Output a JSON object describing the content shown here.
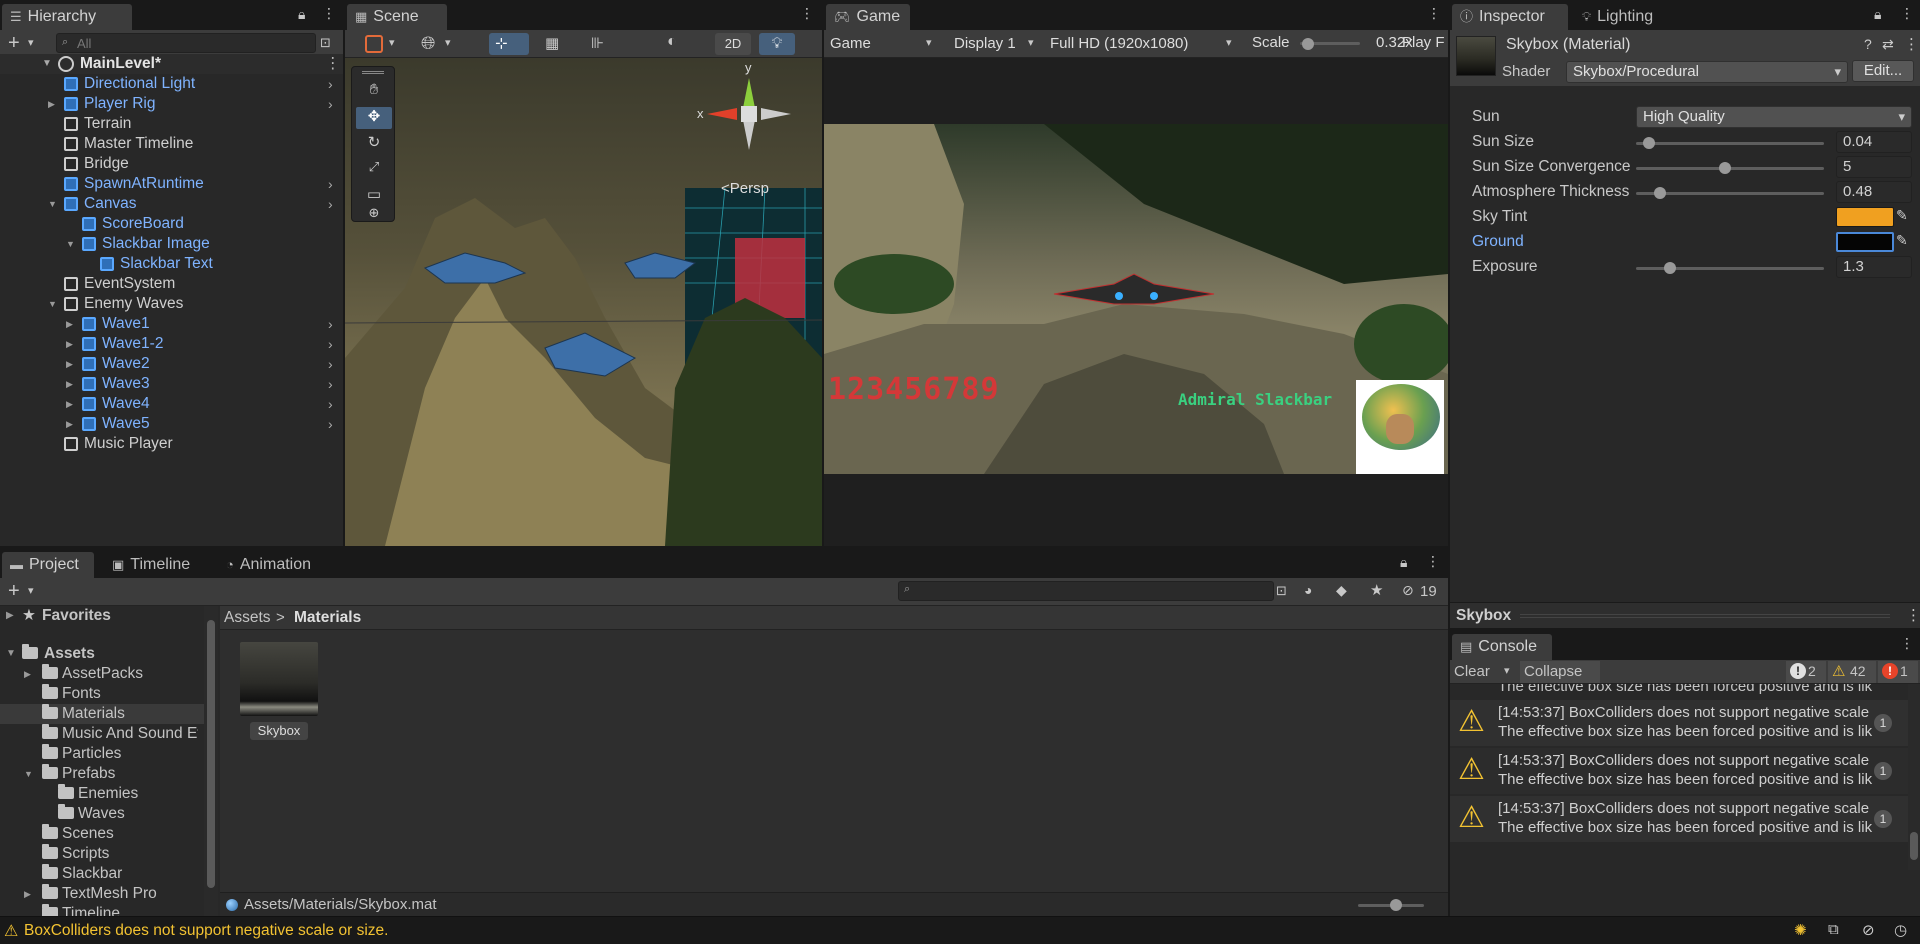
{
  "hierarchy": {
    "tab": "Hierarchy",
    "search_placeholder": "All",
    "scene_name": "MainLevel*",
    "items": [
      {
        "label": "Directional Light",
        "prefab": true,
        "indent": 1,
        "arrow": true,
        "fold": ""
      },
      {
        "label": "Player Rig",
        "prefab": true,
        "indent": 1,
        "arrow": true,
        "fold": "▶"
      },
      {
        "label": "Terrain",
        "prefab": false,
        "indent": 1,
        "arrow": false,
        "fold": ""
      },
      {
        "label": "Master Timeline",
        "prefab": false,
        "indent": 1,
        "arrow": false,
        "fold": ""
      },
      {
        "label": "Bridge",
        "prefab": false,
        "indent": 1,
        "arrow": false,
        "fold": ""
      },
      {
        "label": "SpawnAtRuntime",
        "prefab": true,
        "indent": 1,
        "arrow": true,
        "fold": ""
      },
      {
        "label": "Canvas",
        "prefab": true,
        "indent": 1,
        "arrow": true,
        "fold": "▼"
      },
      {
        "label": "ScoreBoard",
        "prefab": true,
        "indent": 2,
        "arrow": false,
        "fold": ""
      },
      {
        "label": "Slackbar Image",
        "prefab": true,
        "indent": 2,
        "arrow": false,
        "fold": "▼"
      },
      {
        "label": "Slackbar Text",
        "prefab": true,
        "indent": 3,
        "arrow": false,
        "fold": ""
      },
      {
        "label": "EventSystem",
        "prefab": false,
        "indent": 1,
        "arrow": false,
        "fold": ""
      },
      {
        "label": "Enemy Waves",
        "prefab": false,
        "indent": 1,
        "arrow": false,
        "fold": "▼"
      },
      {
        "label": "Wave1",
        "prefab": true,
        "indent": 2,
        "arrow": true,
        "fold": "▶"
      },
      {
        "label": "Wave1-2",
        "prefab": true,
        "indent": 2,
        "arrow": true,
        "fold": "▶"
      },
      {
        "label": "Wave2",
        "prefab": true,
        "indent": 2,
        "arrow": true,
        "fold": "▶"
      },
      {
        "label": "Wave3",
        "prefab": true,
        "indent": 2,
        "arrow": true,
        "fold": "▶"
      },
      {
        "label": "Wave4",
        "prefab": true,
        "indent": 2,
        "arrow": true,
        "fold": "▶"
      },
      {
        "label": "Wave5",
        "prefab": true,
        "indent": 2,
        "arrow": true,
        "fold": "▶"
      },
      {
        "label": "Music Player",
        "prefab": false,
        "indent": 1,
        "arrow": false,
        "fold": ""
      }
    ]
  },
  "scene": {
    "tab": "Scene",
    "btn_2d": "2D",
    "persp_label": "<Persp",
    "gizmo_x": "x",
    "gizmo_y": "y"
  },
  "game": {
    "tab": "Game",
    "mode": "Game",
    "display": "Display 1",
    "resolution": "Full HD (1920x1080)",
    "scale_label": "Scale",
    "scale_value": "0.32x",
    "play_label": "Play F",
    "score_text": "123456789",
    "name_text": "Admiral Slackbar"
  },
  "inspector": {
    "tab_inspector": "Inspector",
    "tab_lighting": "Lighting",
    "material_title": "Skybox (Material)",
    "shader_label": "Shader",
    "shader_value": "Skybox/Procedural",
    "edit_button": "Edit...",
    "properties": {
      "sun_label": "Sun",
      "sun_value": "High Quality",
      "sun_size_label": "Sun Size",
      "sun_size_value": "0.04",
      "sun_size_fraction": 0.04,
      "convergence_label": "Sun Size Convergence",
      "convergence_value": "5",
      "convergence_fraction": 0.47,
      "atmosphere_label": "Atmosphere Thickness",
      "atmosphere_value": "0.48",
      "atmosphere_fraction": 0.1,
      "sky_tint_label": "Sky Tint",
      "sky_tint_color": "#f0a020",
      "ground_label": "Ground",
      "ground_color": "#050505",
      "exposure_label": "Exposure",
      "exposure_value": "1.3",
      "exposure_fraction": 0.16
    },
    "preview_title": "Skybox"
  },
  "project": {
    "tab_project": "Project",
    "tab_timeline": "Timeline",
    "tab_animation": "Animation",
    "hidden_count": "19",
    "favorites": "Favorites",
    "assets_root": "Assets",
    "folders": [
      {
        "label": "AssetPacks",
        "indent": 1,
        "fold": "▶"
      },
      {
        "label": "Fonts",
        "indent": 1,
        "fold": ""
      },
      {
        "label": "Materials",
        "indent": 1,
        "fold": "",
        "selected": true
      },
      {
        "label": "Music And Sound Ef",
        "indent": 1,
        "fold": ""
      },
      {
        "label": "Particles",
        "indent": 1,
        "fold": ""
      },
      {
        "label": "Prefabs",
        "indent": 1,
        "fold": "▼"
      },
      {
        "label": "Enemies",
        "indent": 2,
        "fold": ""
      },
      {
        "label": "Waves",
        "indent": 2,
        "fold": ""
      },
      {
        "label": "Scenes",
        "indent": 1,
        "fold": ""
      },
      {
        "label": "Scripts",
        "indent": 1,
        "fold": ""
      },
      {
        "label": "Slackbar",
        "indent": 1,
        "fold": ""
      },
      {
        "label": "TextMesh Pro",
        "indent": 1,
        "fold": "▶"
      },
      {
        "label": "Timeline",
        "indent": 1,
        "fold": ""
      }
    ],
    "breadcrumb_root": "Assets",
    "breadcrumb_current": "Materials",
    "asset_name": "Skybox",
    "asset_path": "Assets/Materials/Skybox.mat"
  },
  "console": {
    "tab": "Console",
    "clear": "Clear",
    "collapse": "Collapse",
    "info_count": "2",
    "warn_count": "42",
    "error_count": "1",
    "partial_line": "The effective box size has been forced positive and is lik",
    "entries": [
      {
        "line1": "[14:53:37] BoxColliders does not support negative scale",
        "line2": "The effective box size has been forced positive and is lik",
        "count": "1"
      },
      {
        "line1": "[14:53:37] BoxColliders does not support negative scale",
        "line2": "The effective box size has been forced positive and is lik",
        "count": "1"
      },
      {
        "line1": "[14:53:37] BoxColliders does not support negative scale",
        "line2": "The effective box size has been forced positive and is lik",
        "count": "1"
      }
    ]
  },
  "status_bar": {
    "message": "BoxColliders does not support negative scale or size."
  }
}
